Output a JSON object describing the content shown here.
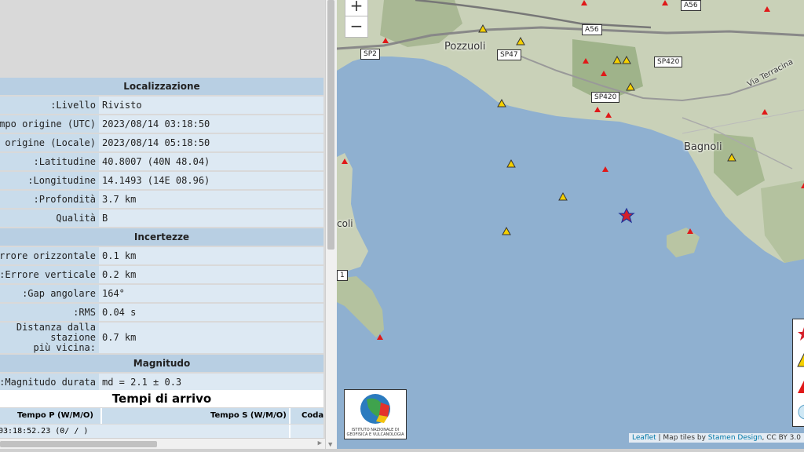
{
  "localizzazione": {
    "title": "Localizzazione",
    "rows": [
      {
        "label": "Livello:",
        "value": "Rivisto"
      },
      {
        "label": "Tempo origine (UTC):",
        "value": "2023/08/14 03:18:50"
      },
      {
        "label": "Tempo origine (Locale):",
        "value": "2023/08/14 05:18:50"
      },
      {
        "label": "Latitudine:",
        "value": "40.8007 (40N 48.04)"
      },
      {
        "label": "Longitudine:",
        "value": "14.1493 (14E 08.96)"
      },
      {
        "label": "Profondità:",
        "value": "3.7 km"
      },
      {
        "label": "Qualità",
        "value": "B"
      }
    ]
  },
  "incertezze": {
    "title": "Incertezze",
    "rows": [
      {
        "label": "Errore orizzontale:",
        "value": "0.1 km"
      },
      {
        "label": "Errore verticale:",
        "value": "0.2 km"
      },
      {
        "label": "Gap angolare:",
        "value": "164°"
      },
      {
        "label": "RMS:",
        "value": "0.04 s"
      }
    ],
    "distance_label_1": "Distanza dalla stazione",
    "distance_label_2": "più vicina:",
    "distance_value": "0.7 km"
  },
  "magnitudo": {
    "title": "Magnitudo",
    "label": "Magnitudo durata:",
    "value": "md = 2.1 ± 0.3"
  },
  "arrivi": {
    "title": "Tempi di arrivo",
    "col_p": "Tempo P (W/M/O)",
    "col_s": "Tempo S (W/M/O)",
    "col_coda": "Coda",
    "row_p": "03:18:52.23 (0/ / )"
  },
  "map": {
    "zoom_in": "+",
    "zoom_out": "−",
    "places": {
      "pozzuoli": "Pozzuoli",
      "bagnoli": "Bagnoli",
      "baia_fragment": "coli",
      "via_terracina": "Via Terracina",
      "edge_label": "1"
    },
    "roads": {
      "sp2": "SP2",
      "sp47": "SP47",
      "a56_top": "A56",
      "a56": "A56",
      "sp420_right": "SP420",
      "sp420": "SP420"
    },
    "logo_text": "ISTITUTO NAZIONALE DI GEOFISICA E VULCANOLOGIA",
    "attribution_link": "Leaflet",
    "attribution_text": " | Map tiles by ",
    "attribution_link2": "Stamen Design",
    "attribution_rest": ", CC BY 3.0",
    "colors": {
      "sea": "#8fb0d0",
      "land": "#c9d1b8",
      "station_fill": "#f5d000",
      "event_star": "#d4202a",
      "red_triangle": "#e01818"
    }
  }
}
